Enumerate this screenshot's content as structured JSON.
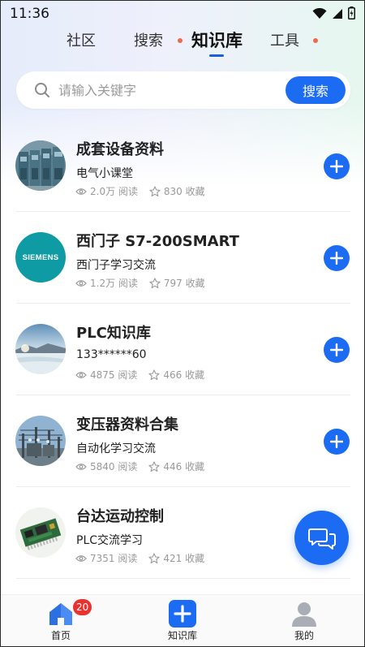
{
  "status_bar": {
    "time": "11:36"
  },
  "top_tabs": [
    {
      "label": "社区",
      "active": false
    },
    {
      "label": "搜索",
      "active": false
    },
    {
      "label": "知识库",
      "active": true
    },
    {
      "label": "工具",
      "active": false
    }
  ],
  "search": {
    "placeholder": "请输入关键字",
    "value": "",
    "button_label": "搜索"
  },
  "items": [
    {
      "title": "成套设备资料",
      "subtitle": "电气小课堂",
      "reads": "2.0万 阅读",
      "favorites": "830 收藏",
      "thumb_icon": "switchgear-cabinet-image"
    },
    {
      "title": "西门子 S7-200SMART",
      "subtitle": "西门子学习交流",
      "reads": "1.2万 阅读",
      "favorites": "797 收藏",
      "thumb_icon": "siemens-logo",
      "thumb_text": "SIEMENS"
    },
    {
      "title": "PLC知识库",
      "subtitle": "133******60",
      "reads": "4875 阅读",
      "favorites": "466 收藏",
      "thumb_icon": "landscape-image"
    },
    {
      "title": "变压器资料合集",
      "subtitle": "自动化学习交流",
      "reads": "5840 阅读",
      "favorites": "446 收藏",
      "thumb_icon": "transformer-substation-image"
    },
    {
      "title": "台达运动控制",
      "subtitle": "PLC交流学习",
      "reads": "7351 阅读",
      "favorites": "421 收藏",
      "thumb_icon": "circuit-board-image"
    }
  ],
  "bottom_nav": [
    {
      "label": "首页",
      "icon": "home-icon",
      "badge": "20"
    },
    {
      "label": "知识库",
      "icon": "add-knowledge-icon"
    },
    {
      "label": "我的",
      "icon": "profile-icon"
    }
  ],
  "colors": {
    "accent": "#1b6cf2",
    "badge": "#e8322f",
    "tab_dot": "#f06a4a"
  }
}
